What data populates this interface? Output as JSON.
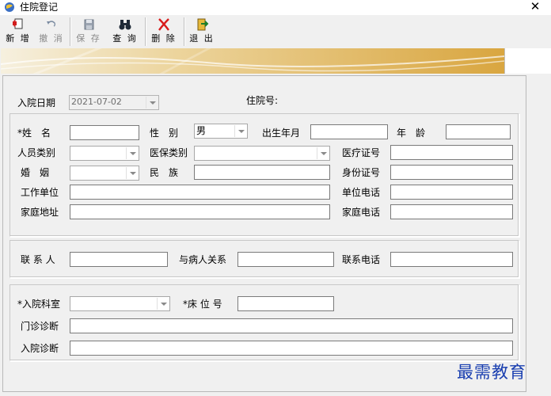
{
  "window": {
    "title": "住院登记",
    "close_glyph": "✕"
  },
  "toolbar": {
    "new_label": "新 增",
    "undo_label": "撤 消",
    "save_label": "保 存",
    "query_label": "查 询",
    "delete_label": "删 除",
    "exit_label": "退 出"
  },
  "header": {
    "admit_date_label": "入院日期",
    "admit_date_value": "2021-07-02",
    "admission_no_label": "住院号:"
  },
  "patient": {
    "name_label": "*姓　名",
    "sex_label": "性　别",
    "sex_value": "男",
    "birth_label": "出生年月",
    "age_label": "年　龄",
    "person_type_label": "人员类别",
    "insurance_type_label": "医保类别",
    "medical_card_label": "医疗证号",
    "marriage_label": "婚　姻",
    "ethnic_label": "民　族",
    "id_card_label": "身份证号",
    "work_unit_label": "工作单位",
    "unit_phone_label": "单位电话",
    "home_address_label": "家庭地址",
    "home_phone_label": "家庭电话"
  },
  "contact": {
    "contact_label": "联 系 人",
    "relation_label": "与病人关系",
    "contact_phone_label": "联系电话"
  },
  "admission": {
    "dept_label": "*入院科室",
    "bed_label": "*床 位 号",
    "outpatient_diag_label": "门诊诊断",
    "admit_diag_label": "入院诊断"
  },
  "watermark": {
    "text": "最需教育"
  },
  "colors": {
    "watermark": "#1a3fb0",
    "banner": "#e8c878",
    "window_bg": "#f0f0f0"
  },
  "icons": {
    "title": "app-globe-icon",
    "new": "new-record-icon",
    "undo": "undo-icon",
    "save": "floppy-disk-icon",
    "query": "binoculars-icon",
    "delete": "red-x-icon",
    "exit": "exit-door-icon"
  }
}
